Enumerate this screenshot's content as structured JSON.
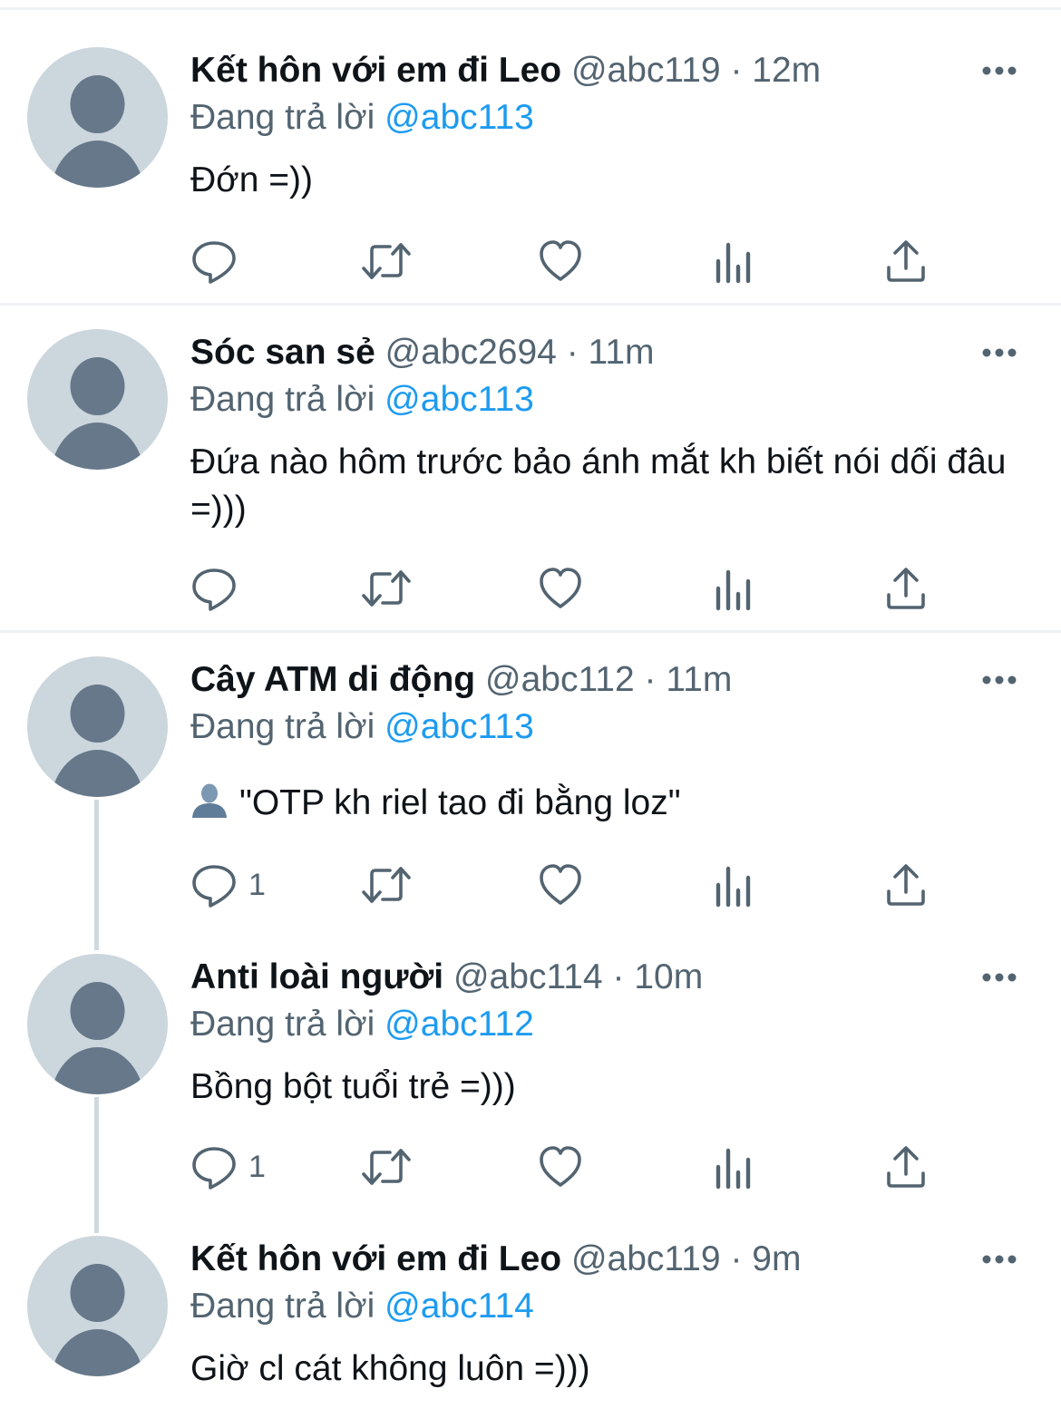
{
  "tweets": [
    {
      "name": "Kết hôn với em đi Leo",
      "handle": "@abc119",
      "dot": "·",
      "time": "12m",
      "replying_prefix": "Đang trả lời",
      "replying_to": "@abc113",
      "text": "Đớn =))",
      "reply_count": ""
    },
    {
      "name": "Sóc san sẻ",
      "handle": "@abc2694",
      "dot": "·",
      "time": "11m",
      "replying_prefix": "Đang trả lời",
      "replying_to": "@abc113",
      "text": "Đứa nào hôm trước bảo ánh mắt kh biết nói dối đâu =)))",
      "reply_count": ""
    },
    {
      "name": "Cây ATM di động",
      "handle": "@abc112",
      "dot": "·",
      "time": "11m",
      "replying_prefix": "Đang trả lời",
      "replying_to": "@abc113",
      "text": "\"OTP kh riel tao đi bằng loz\"",
      "text_emoji": "bust-in-silhouette-icon",
      "reply_count": "1"
    },
    {
      "name": "Anti loài người",
      "handle": "@abc114",
      "dot": "·",
      "time": "10m",
      "replying_prefix": "Đang trả lời",
      "replying_to": "@abc112",
      "text": "Bồng bột tuổi trẻ =)))",
      "reply_count": "1"
    },
    {
      "name": "Kết hôn với em đi Leo",
      "handle": "@abc119",
      "dot": "·",
      "time": "9m",
      "replying_prefix": "Đang trả lời",
      "replying_to": "@abc114",
      "text": "Giờ cl cát không luôn =)))",
      "reply_count": ""
    }
  ],
  "icons": {
    "reply": "comment-bubble-icon",
    "retweet": "retweet-arrows-icon",
    "like": "heart-icon",
    "views": "bar-chart-icon",
    "share": "share-upload-icon",
    "more": "more-dots-icon"
  },
  "colors": {
    "text": "#0f1419",
    "secondary": "#536471",
    "mention": "#1d9bf0",
    "avatar_bg": "#ccd6dd",
    "avatar_figure": "#66788a",
    "divider": "#eff3f4",
    "thread_line": "#cfd9de"
  }
}
